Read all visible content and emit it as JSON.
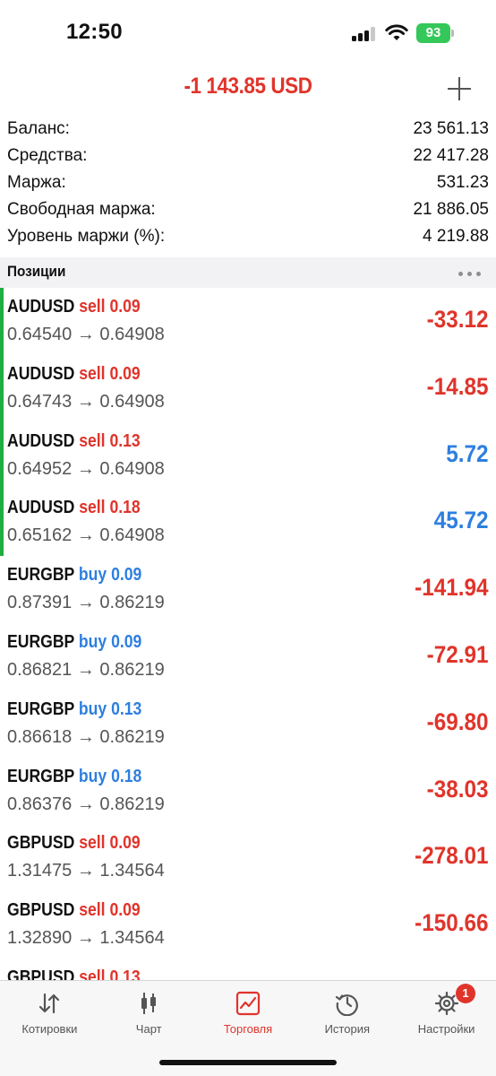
{
  "status_bar": {
    "time": "12:50",
    "battery": "93"
  },
  "header": {
    "total": "-1 143.85 USD"
  },
  "summary": [
    {
      "label": "Баланс:",
      "value": "23 561.13"
    },
    {
      "label": "Средства:",
      "value": "22 417.28"
    },
    {
      "label": "Маржа:",
      "value": "531.23"
    },
    {
      "label": "Свободная маржа:",
      "value": "21 886.05"
    },
    {
      "label": "Уровень маржи (%):",
      "value": "4 219.88"
    }
  ],
  "positions_title": "Позиции",
  "positions": [
    {
      "symbol": "AUDUSD",
      "side": "sell",
      "volume": "0.09",
      "prices": "0.64540 → 0.64908",
      "profit": "-33.12",
      "accent": true
    },
    {
      "symbol": "AUDUSD",
      "side": "sell",
      "volume": "0.09",
      "prices": "0.64743 → 0.64908",
      "profit": "-14.85",
      "accent": true
    },
    {
      "symbol": "AUDUSD",
      "side": "sell",
      "volume": "0.13",
      "prices": "0.64952 → 0.64908",
      "profit": "5.72",
      "accent": true
    },
    {
      "symbol": "AUDUSD",
      "side": "sell",
      "volume": "0.18",
      "prices": "0.65162 → 0.64908",
      "profit": "45.72",
      "accent": true
    },
    {
      "symbol": "EURGBP",
      "side": "buy",
      "volume": "0.09",
      "prices": "0.87391 → 0.86219",
      "profit": "-141.94",
      "accent": false
    },
    {
      "symbol": "EURGBP",
      "side": "buy",
      "volume": "0.09",
      "prices": "0.86821 → 0.86219",
      "profit": "-72.91",
      "accent": false
    },
    {
      "symbol": "EURGBP",
      "side": "buy",
      "volume": "0.13",
      "prices": "0.86618 → 0.86219",
      "profit": "-69.80",
      "accent": false
    },
    {
      "symbol": "EURGBP",
      "side": "buy",
      "volume": "0.18",
      "prices": "0.86376 → 0.86219",
      "profit": "-38.03",
      "accent": false
    },
    {
      "symbol": "GBPUSD",
      "side": "sell",
      "volume": "0.09",
      "prices": "1.31475 → 1.34564",
      "profit": "-278.01",
      "accent": false
    },
    {
      "symbol": "GBPUSD",
      "side": "sell",
      "volume": "0.09",
      "prices": "1.32890 → 1.34564",
      "profit": "-150.66",
      "accent": false
    },
    {
      "symbol": "GBPUSD",
      "side": "sell",
      "volume": "0.13",
      "prices": "",
      "profit": "",
      "accent": false
    }
  ],
  "tabs": [
    {
      "label": "Котировки",
      "icon": "quotes-arrows-icon",
      "active": false
    },
    {
      "label": "Чарт",
      "icon": "candlestick-chart-icon",
      "active": false
    },
    {
      "label": "Торговля",
      "icon": "trade-chart-icon",
      "active": true
    },
    {
      "label": "История",
      "icon": "history-clock-icon",
      "active": false
    },
    {
      "label": "Настройки",
      "icon": "settings-gear-icon",
      "active": false
    }
  ],
  "settings_badge": "1",
  "colors": {
    "loss": "#e0342b",
    "profit": "#2d7fe0",
    "accent_bar": "#1fae3f",
    "battery": "#34c759"
  }
}
